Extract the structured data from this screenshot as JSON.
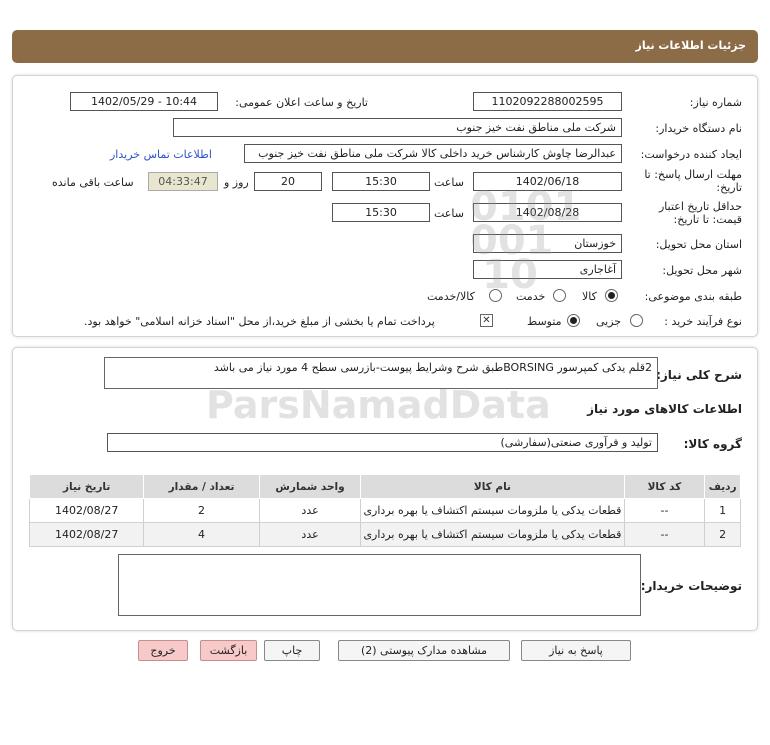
{
  "header": {
    "title": "جزئیات اطلاعات نیاز"
  },
  "form": {
    "need_number_label": "شماره نیاز:",
    "need_number": "1102092288002595",
    "announce_label": "تاریخ و ساعت اعلان عمومی:",
    "announce_value": "1402/05/29 - 10:44",
    "buyer_org_label": "نام دستگاه خریدار:",
    "buyer_org": "شرکت ملی مناطق نفت خیز جنوب",
    "requester_label": "ایجاد کننده درخواست:",
    "requester": "عبدالرضا چاوش  کارشناس خرید داخلی کالا شرکت ملی مناطق نفت خیز جنوب",
    "contact_link": "اطلاعات تماس خریدار",
    "send_deadline_label_1": "مهلت ارسال پاسخ: تا",
    "send_deadline_label_2": "تاریخ:",
    "send_date": "1402/06/18",
    "time_label": "ساعت",
    "send_time": "15:30",
    "days": "20",
    "days_label": "روز و",
    "remaining_time": "04:33:47",
    "remaining_label": "ساعت باقی مانده",
    "validity_label_1": "حداقل تاریخ اعتبار",
    "validity_label_2": "قیمت: تا تاریخ:",
    "validity_date": "1402/08/28",
    "validity_time": "15:30",
    "province_label": "استان محل تحویل:",
    "province": "خوزستان",
    "city_label": "شهر محل تحویل:",
    "city": "آغاجاری",
    "category_label": "طبقه بندی موضوعی:",
    "category_options": [
      "کالا",
      "خدمت",
      "کالا/خدمت"
    ],
    "process_label": "نوع فرآیند خرید :",
    "process_options": [
      "جزیی",
      "متوسط"
    ],
    "payment_note": "پرداخت تمام یا بخشی از مبلغ خرید،از محل \"اسناد خزانه اسلامی\" خواهد بود."
  },
  "details": {
    "description_label": "شرح کلی نیاز:",
    "description": "2قلم یدکی کمپرسور BORSINGطبق شرح وشرایط پیوست-بازرسی سطح 4 مورد نیاز می باشد",
    "goods_info_title": "اطلاعات کالاهای مورد نیاز",
    "goods_group_label": "گروه کالا:",
    "goods_group": "تولید و فرآوری صنعتی(سفارشی)",
    "table": {
      "headers": [
        "ردیف",
        "کد کالا",
        "نام کالا",
        "واحد شمارش",
        "تعداد / مقدار",
        "تاریخ نیاز"
      ],
      "rows": [
        [
          "1",
          "--",
          "قطعات یدکی یا ملزومات سیستم اکتشاف یا بهره برداری",
          "عدد",
          "2",
          "1402/08/27"
        ],
        [
          "2",
          "--",
          "قطعات یدکی یا ملزومات سیستم اکتشاف یا بهره برداری",
          "عدد",
          "4",
          "1402/08/27"
        ]
      ]
    },
    "buyer_notes_label": "توضیحات خریدار:",
    "buyer_notes": ""
  },
  "buttons": {
    "reply": "پاسخ به نیاز",
    "attachments": "مشاهده مدارک پیوستی (2)",
    "print": "چاپ",
    "back": "بازگشت",
    "exit": "خروج"
  },
  "watermark": {
    "brand": "ParsNamadData",
    "number": "0101 001 10"
  }
}
